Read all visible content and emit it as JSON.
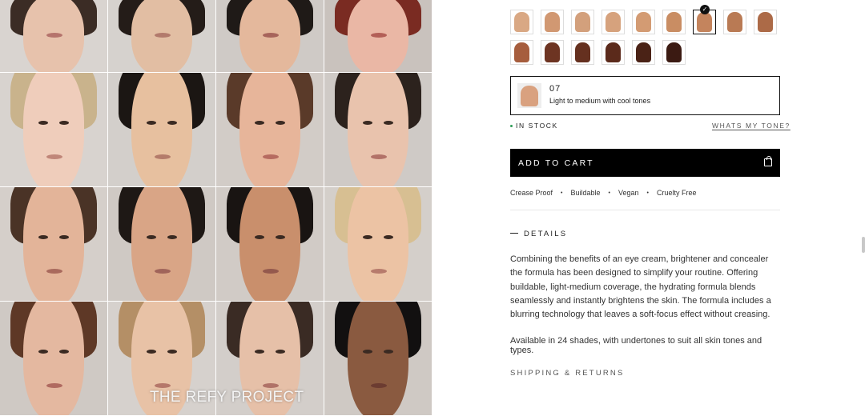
{
  "gallery": {
    "watermark": "THE REFY PROJECT",
    "faces": [
      {
        "skin": "#e7c2ac",
        "hair": "#3b2c25",
        "bg": "#d9d4d0",
        "lips": "#b5736c"
      },
      {
        "skin": "#e2bea3",
        "hair": "#241c18",
        "bg": "#d6d2ce",
        "lips": "#b27a6c"
      },
      {
        "skin": "#e4b89c",
        "hair": "#1f1a17",
        "bg": "#cfcac6",
        "lips": "#a7645b"
      },
      {
        "skin": "#eab7a5",
        "hair": "#7a2b22",
        "bg": "#c9c2bd",
        "lips": "#b35f57"
      },
      {
        "skin": "#efcdbb",
        "hair": "#c9b38c",
        "bg": "#d8d3cf",
        "lips": "#c08679"
      },
      {
        "skin": "#e7c09f",
        "hair": "#1b1613",
        "bg": "#d3cfcb",
        "lips": "#b47b6a"
      },
      {
        "skin": "#e7b59a",
        "hair": "#5a3a29",
        "bg": "#d2ccc7",
        "lips": "#b66b60"
      },
      {
        "skin": "#e9c3ad",
        "hair": "#2c221d",
        "bg": "#cfcac6",
        "lips": "#b27268"
      },
      {
        "skin": "#e3b499",
        "hair": "#4a3326",
        "bg": "#d5cfca",
        "lips": "#a96a5d"
      },
      {
        "skin": "#d9a586",
        "hair": "#1e1815",
        "bg": "#cfc9c4",
        "lips": "#a0645a"
      },
      {
        "skin": "#c98f6c",
        "hair": "#191412",
        "bg": "#d1cbc6",
        "lips": "#94594d"
      },
      {
        "skin": "#ecc3a4",
        "hair": "#d7bf92",
        "bg": "#d4cfca",
        "lips": "#b77b6c"
      },
      {
        "skin": "#e4b8a0",
        "hair": "#5e3826",
        "bg": "#cfc9c4",
        "lips": "#b06a60"
      },
      {
        "skin": "#e8c2a6",
        "hair": "#b48f66",
        "bg": "#d6d1cd",
        "lips": "#b5776a"
      },
      {
        "skin": "#e6c0a8",
        "hair": "#3a2b24",
        "bg": "#d3ceca",
        "lips": "#b07267"
      },
      {
        "skin": "#8a5a40",
        "hair": "#121010",
        "bg": "#cfc9c4",
        "lips": "#6c3c31"
      }
    ]
  },
  "swatches": {
    "rows": [
      [
        "#d9a884",
        "#d19872",
        "#d3a07c",
        "#d6a27d",
        "#d39b73",
        "#c98d63",
        "#c4845d",
        "#b97a54",
        "#ac6a47"
      ],
      [
        "#a65d3d",
        "#6d3422",
        "#65301f",
        "#5b2a1b",
        "#4a2216",
        "#3b1a12"
      ]
    ],
    "selected_index": 6
  },
  "shade": {
    "number": "07",
    "description": "Light to medium with cool tones"
  },
  "stock": {
    "label": "IN STOCK",
    "tone_link": "WHATS MY TONE?",
    "status_color": "#2e9d57"
  },
  "cart": {
    "label": "ADD TO CART",
    "icon": "shopping-bag-icon"
  },
  "attributes": [
    "Crease Proof",
    "Buildable",
    "Vegan",
    "Cruelty Free"
  ],
  "details": {
    "heading": "DETAILS",
    "body": "Combining the benefits of an eye cream, brightener and concealer the formula has been designed to simplify your routine. Offering buildable, light-medium coverage, the hydrating formula blends seamlessly and instantly brightens the skin. The formula includes a blurring technology that leaves a soft-focus effect without creasing.",
    "availability": "Available in 24 shades, with undertones to suit all skin tones and types."
  },
  "shipping": {
    "label": "SHIPPING & RETURNS"
  }
}
